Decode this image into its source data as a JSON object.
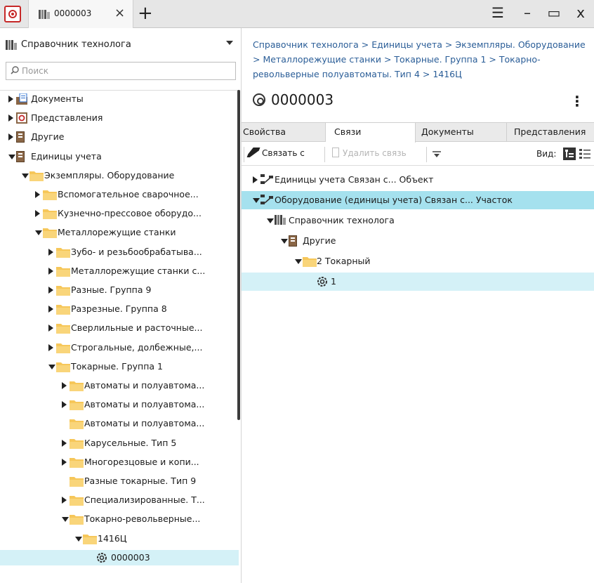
{
  "window": {
    "tab_title": "0000003",
    "tab_close": "×",
    "new_tab": "+",
    "menu": "☰",
    "minimize": "–",
    "maximize": "▭",
    "close": "x"
  },
  "left": {
    "catalog_label": "Справочник технолога",
    "search_placeholder": "Поиск",
    "tree": [
      {
        "label": "Документы",
        "depth": 0,
        "expand": "collapsed",
        "icon": "documents-icon"
      },
      {
        "label": "Представления",
        "depth": 0,
        "expand": "collapsed",
        "icon": "views-icon"
      },
      {
        "label": "Другие",
        "depth": 0,
        "expand": "collapsed",
        "icon": "book-icon"
      },
      {
        "label": "Единицы учета",
        "depth": 0,
        "expand": "expanded",
        "icon": "book-icon"
      },
      {
        "label": "Экземпляры. Оборудование",
        "depth": 1,
        "expand": "expanded",
        "icon": "folder-icon"
      },
      {
        "label": "Вспомогательное сварочное...",
        "depth": 2,
        "expand": "collapsed",
        "icon": "folder-icon"
      },
      {
        "label": "Кузнечно-прессовое оборудо...",
        "depth": 2,
        "expand": "collapsed",
        "icon": "folder-icon"
      },
      {
        "label": "Металлорежущие станки",
        "depth": 2,
        "expand": "expanded",
        "icon": "folder-icon"
      },
      {
        "label": "Зубо- и резьбообрабатыва...",
        "depth": 3,
        "expand": "collapsed",
        "icon": "folder-icon"
      },
      {
        "label": "Металлорежущие станки с...",
        "depth": 3,
        "expand": "collapsed",
        "icon": "folder-icon"
      },
      {
        "label": "Разные. Группа 9",
        "depth": 3,
        "expand": "collapsed",
        "icon": "folder-icon"
      },
      {
        "label": "Разрезные. Группа 8",
        "depth": 3,
        "expand": "collapsed",
        "icon": "folder-icon"
      },
      {
        "label": "Сверлильные и расточные...",
        "depth": 3,
        "expand": "collapsed",
        "icon": "folder-icon"
      },
      {
        "label": "Строгальные, долбежные,...",
        "depth": 3,
        "expand": "collapsed",
        "icon": "folder-icon"
      },
      {
        "label": "Токарные. Группа 1",
        "depth": 3,
        "expand": "expanded",
        "icon": "folder-icon"
      },
      {
        "label": "Автоматы и полуавтома...",
        "depth": 4,
        "expand": "collapsed",
        "icon": "folder-icon"
      },
      {
        "label": "Автоматы и полуавтома...",
        "depth": 4,
        "expand": "collapsed",
        "icon": "folder-icon"
      },
      {
        "label": "Автоматы и полуавтома...",
        "depth": 4,
        "expand": "none",
        "icon": "folder-icon"
      },
      {
        "label": "Карусельные. Тип 5",
        "depth": 4,
        "expand": "collapsed",
        "icon": "folder-icon"
      },
      {
        "label": "Многорезцовые и копи...",
        "depth": 4,
        "expand": "collapsed",
        "icon": "folder-icon"
      },
      {
        "label": "Разные токарные. Тип 9",
        "depth": 4,
        "expand": "none",
        "icon": "folder-icon"
      },
      {
        "label": "Специализированные. Т...",
        "depth": 4,
        "expand": "collapsed",
        "icon": "folder-icon"
      },
      {
        "label": "Токарно-револьверные...",
        "depth": 4,
        "expand": "expanded",
        "icon": "folder-icon"
      },
      {
        "label": "1416Ц",
        "depth": 5,
        "expand": "expanded",
        "icon": "folder-icon"
      },
      {
        "label": "0000003",
        "depth": 6,
        "expand": "none",
        "icon": "gear-icon",
        "selected": true
      }
    ]
  },
  "right": {
    "breadcrumb": "Справочник технолога > Единицы учета > Экземпляры. Оборудование > Металлорежущие станки > Токарные. Группа 1 > Токарно-револьверные полуавтоматы. Тип 4 > 1416Ц",
    "title": "0000003",
    "more": "⋮",
    "tabs": [
      "Свойства",
      "Связи",
      "Документы",
      "Представления"
    ],
    "toolbar": {
      "link": "Связать с",
      "unlink": "Удалить связь",
      "view_label": "Вид:"
    },
    "relations": [
      {
        "label": "Единицы учета Связан с... Объект",
        "depth": 0,
        "expand": "collapsed",
        "icon": "relation-icon",
        "state": "normal"
      },
      {
        "label": "Оборудование (единицы учета) Связан с... Участок",
        "depth": 0,
        "expand": "expanded",
        "icon": "relation-icon",
        "state": "highlight"
      },
      {
        "label": "Справочник технолога",
        "depth": 1,
        "expand": "expanded",
        "icon": "catalog-icon",
        "state": "normal"
      },
      {
        "label": "Другие",
        "depth": 2,
        "expand": "expanded",
        "icon": "book-icon",
        "state": "normal"
      },
      {
        "label": "2 Токарный",
        "depth": 3,
        "expand": "expanded",
        "icon": "folder-icon",
        "state": "normal"
      },
      {
        "label": "1",
        "depth": 4,
        "expand": "none",
        "icon": "gear-icon",
        "state": "selected"
      }
    ]
  }
}
